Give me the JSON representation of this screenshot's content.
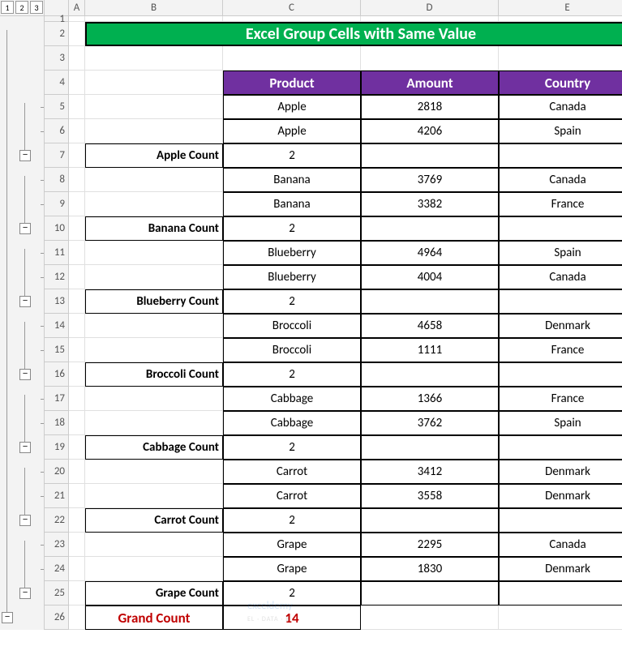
{
  "outline": {
    "levels": [
      "1",
      "2",
      "3"
    ],
    "collapse_glyph": "−"
  },
  "columns": [
    "A",
    "B",
    "C",
    "D",
    "E"
  ],
  "row_numbers": [
    "1",
    "2",
    "3",
    "4",
    "5",
    "6",
    "7",
    "8",
    "9",
    "10",
    "11",
    "12",
    "13",
    "14",
    "15",
    "16",
    "17",
    "18",
    "19",
    "20",
    "21",
    "22",
    "23",
    "24",
    "25",
    "26"
  ],
  "title": "Excel Group Cells with Same Value",
  "headers": {
    "product": "Product",
    "amount": "Amount",
    "country": "Country"
  },
  "groups": [
    {
      "label": "Apple Count",
      "count": "2",
      "rows": [
        {
          "product": "Apple",
          "amount": "2818",
          "country": "Canada"
        },
        {
          "product": "Apple",
          "amount": "4206",
          "country": "Spain"
        }
      ]
    },
    {
      "label": "Banana Count",
      "count": "2",
      "rows": [
        {
          "product": "Banana",
          "amount": "3769",
          "country": "Canada"
        },
        {
          "product": "Banana",
          "amount": "3382",
          "country": "France"
        }
      ]
    },
    {
      "label": "Blueberry Count",
      "count": "2",
      "rows": [
        {
          "product": "Blueberry",
          "amount": "4964",
          "country": "Spain"
        },
        {
          "product": "Blueberry",
          "amount": "4004",
          "country": "Canada"
        }
      ]
    },
    {
      "label": "Broccoli Count",
      "count": "2",
      "rows": [
        {
          "product": "Broccoli",
          "amount": "4658",
          "country": "Denmark"
        },
        {
          "product": "Broccoli",
          "amount": "1111",
          "country": "France"
        }
      ]
    },
    {
      "label": "Cabbage Count",
      "count": "2",
      "rows": [
        {
          "product": "Cabbage",
          "amount": "1366",
          "country": "France"
        },
        {
          "product": "Cabbage",
          "amount": "3762",
          "country": "Spain"
        }
      ]
    },
    {
      "label": "Carrot Count",
      "count": "2",
      "rows": [
        {
          "product": "Carrot",
          "amount": "3412",
          "country": "Denmark"
        },
        {
          "product": "Carrot",
          "amount": "3558",
          "country": "Denmark"
        }
      ]
    },
    {
      "label": "Grape Count",
      "count": "2",
      "rows": [
        {
          "product": "Grape",
          "amount": "2295",
          "country": "Canada"
        },
        {
          "product": "Grape",
          "amount": "1830",
          "country": "Denmark"
        }
      ]
    }
  ],
  "grand": {
    "label": "Grand Count",
    "value": "14"
  },
  "watermark": {
    "brand": "exceldemy",
    "tag": "EL · DATA · B"
  },
  "chart_data": {
    "type": "table",
    "title": "Excel Group Cells with Same Value",
    "columns": [
      "Product",
      "Amount",
      "Country"
    ],
    "rows": [
      [
        "Apple",
        2818,
        "Canada"
      ],
      [
        "Apple",
        4206,
        "Spain"
      ],
      [
        "Banana",
        3769,
        "Canada"
      ],
      [
        "Banana",
        3382,
        "France"
      ],
      [
        "Blueberry",
        4964,
        "Spain"
      ],
      [
        "Blueberry",
        4004,
        "Canada"
      ],
      [
        "Broccoli",
        4658,
        "Denmark"
      ],
      [
        "Broccoli",
        1111,
        "France"
      ],
      [
        "Cabbage",
        1366,
        "France"
      ],
      [
        "Cabbage",
        3762,
        "Spain"
      ],
      [
        "Carrot",
        3412,
        "Denmark"
      ],
      [
        "Carrot",
        3558,
        "Denmark"
      ],
      [
        "Grape",
        2295,
        "Canada"
      ],
      [
        "Grape",
        1830,
        "Denmark"
      ]
    ],
    "subtotals": [
      {
        "group": "Apple",
        "count": 2
      },
      {
        "group": "Banana",
        "count": 2
      },
      {
        "group": "Blueberry",
        "count": 2
      },
      {
        "group": "Broccoli",
        "count": 2
      },
      {
        "group": "Cabbage",
        "count": 2
      },
      {
        "group": "Carrot",
        "count": 2
      },
      {
        "group": "Grape",
        "count": 2
      }
    ],
    "grand_count": 14
  }
}
